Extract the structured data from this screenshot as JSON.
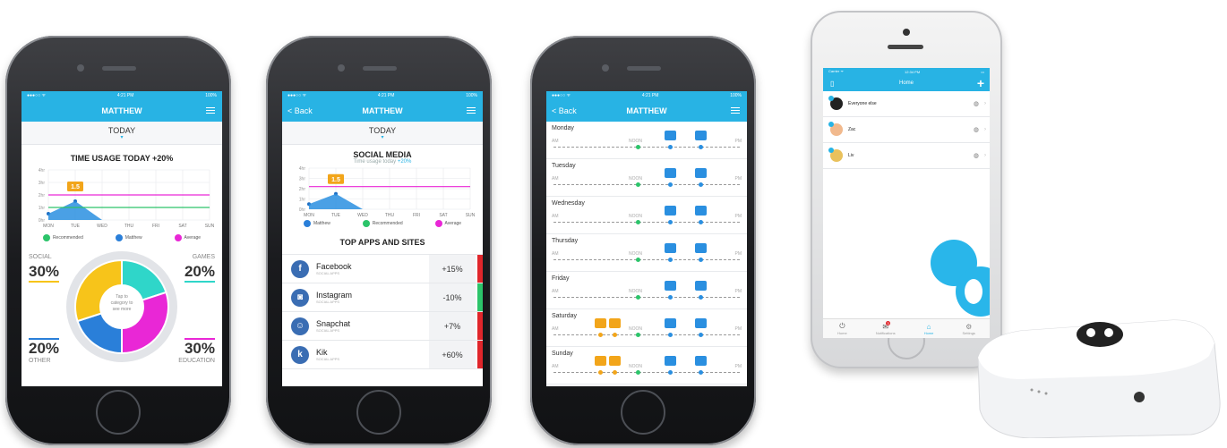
{
  "phone1": {
    "status": {
      "carrier": "●●●○○ ᯤ",
      "time": "4:21 PM",
      "battery": "100%"
    },
    "title": "MATTHEW",
    "period": "TODAY",
    "heading": "TIME USAGE TODAY +20%",
    "chart_data": {
      "type": "area",
      "categories": [
        "MON",
        "TUE",
        "WED",
        "THU",
        "FRI",
        "SAT",
        "SUN"
      ],
      "y_ticks": [
        "4hr",
        "3hr",
        "2hr",
        "1hr",
        "0hr"
      ],
      "values": [
        0.5,
        1.5,
        0,
        0,
        0,
        0,
        0
      ],
      "callout": "1.5",
      "recommended_line": 1,
      "average_line": 2,
      "ylim": [
        0,
        4
      ]
    },
    "legend": [
      "Recommended",
      "Matthew",
      "Average"
    ],
    "donut": {
      "center_text": "Tap to category to see more",
      "segments": [
        {
          "label": "SOCIAL",
          "value": "30%"
        },
        {
          "label": "GAMES",
          "value": "20%"
        },
        {
          "label": "EDUCATION",
          "value": "30%"
        },
        {
          "label": "OTHER",
          "value": "20%"
        }
      ]
    },
    "colors": {
      "social": "#f7c41a",
      "games": "#2fd6c9",
      "education": "#e927d6",
      "other": "#2a7fd9",
      "accent": "#28b3e4"
    }
  },
  "phone2": {
    "status": {
      "carrier": "●●●○○ ᯤ",
      "time": "4:21 PM",
      "battery": "100%"
    },
    "back": "< Back",
    "title": "MATTHEW",
    "period": "TODAY",
    "heading": "SOCIAL MEDIA",
    "subheading": "Time usage today",
    "subheading_delta": "+20%",
    "chart_data": {
      "type": "area",
      "categories": [
        "MON",
        "TUE",
        "WED",
        "THU",
        "FRI",
        "SAT",
        "SUN"
      ],
      "y_ticks": [
        "4hr",
        "3hr",
        "2hr",
        "1hr",
        "0hr"
      ],
      "values": [
        0.5,
        1.5,
        0,
        0,
        0,
        0,
        0
      ],
      "callout": "1.5",
      "ylim": [
        0,
        4
      ]
    },
    "legend": [
      "Matthew",
      "Recommended",
      "Average"
    ],
    "section": "TOP APPS AND SITES",
    "apps": [
      {
        "icon": "f",
        "name": "Facebook",
        "tag": "SOCIAL APPS",
        "change": "+15%",
        "bar": "#e0262b"
      },
      {
        "icon": "◙",
        "name": "Instagram",
        "tag": "SOCIAL APPS",
        "change": "-10%",
        "bar": "#2cc46a"
      },
      {
        "icon": "☺",
        "name": "Snapchat",
        "tag": "SOCIAL APPS",
        "change": "+7%",
        "bar": "#e0262b"
      },
      {
        "icon": "k",
        "name": "Kik",
        "tag": "SOCIAL APPS",
        "change": "+60%",
        "bar": "#e0262b"
      }
    ]
  },
  "phone3": {
    "status": {
      "carrier": "●●●○○ ᯤ",
      "time": "4:21 PM",
      "battery": "100%"
    },
    "back": "< Back",
    "title": "MATTHEW",
    "am": "AM",
    "noon": "NOON",
    "pm": "PM",
    "days": [
      "Monday",
      "Tuesday",
      "Wednesday",
      "Thursday",
      "Friday",
      "Saturday",
      "Sunday"
    ]
  },
  "phone4": {
    "status": {
      "carrier": "Carrier ᯤ",
      "time": "12:34 PM",
      "battery": "▭"
    },
    "title": "Home",
    "add": "+",
    "rows": [
      {
        "name": "Everyone else",
        "icon": "person-silhouette-icon"
      },
      {
        "name": "Zac",
        "icon": "boy-avatar-icon"
      },
      {
        "name": "Liv",
        "icon": "girl-avatar-icon"
      }
    ],
    "tabs": [
      "Home",
      "Notifications",
      "Home",
      "Settings"
    ],
    "badge": "3"
  }
}
